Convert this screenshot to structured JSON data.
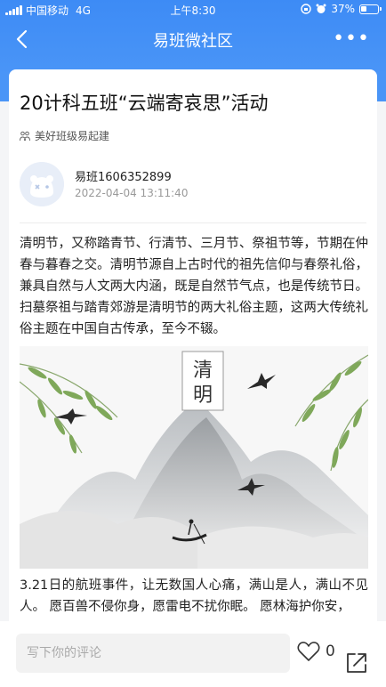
{
  "status_bar": {
    "carrier": "中国移动",
    "network": "4G",
    "time": "上午8:30",
    "battery": "37%"
  },
  "nav": {
    "title": "易班微社区",
    "back_icon": "chevron-left-icon",
    "more_icon": "more-dots-icon",
    "more_label": "•••"
  },
  "post": {
    "title": "20计科五班“云端寄哀思”活动",
    "source": "美好班级易起建",
    "author": {
      "name": "易班1606352899",
      "time": "2022-04-04 13:11:40"
    },
    "paragraph1": "清明节，又称踏青节、行清节、三月节、祭祖节等，节期在仲春与暮春之交。清明节源自上古时代的祖先信仰与春祭礼俗，兼具自然与人文两大内涵，既是自然节气点，也是传统节日。扫墓祭祖与踏青郊游是清明节的两大礼俗主题，这两大传统礼俗主题在中国自古传承，至今不辍。",
    "image": {
      "caption_chars": [
        "清",
        "明"
      ]
    },
    "paragraph2": "3.21日的航班事件，让无数国人心痛，满山是人，满山不见人。 愿百兽不侵你身，愿雷电不扰你眠。 愿林海护你安，"
  },
  "bottom": {
    "comment_placeholder": "写下你的评论",
    "like_count": "0",
    "like_icon": "heart-icon",
    "share_icon": "share-icon"
  },
  "colors": {
    "header_blue": "#4a95f7"
  }
}
